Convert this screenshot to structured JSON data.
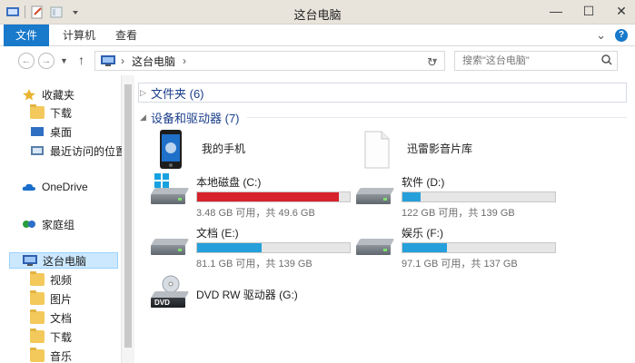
{
  "window": {
    "title": "这台电脑"
  },
  "window_controls": {
    "minimize": "—",
    "maximize": "☐",
    "close": "✕"
  },
  "ribbon": {
    "file_tab": "文件",
    "tabs": [
      "计算机",
      "查看"
    ],
    "chevron": "⌄",
    "help": "?"
  },
  "address": {
    "crumb": "这台电脑",
    "arrow": "›",
    "search_placeholder": "搜索\"这台电脑\""
  },
  "sidebar": {
    "favorites": {
      "label": "收藏夹",
      "items": [
        "下载",
        "桌面",
        "最近访问的位置"
      ]
    },
    "onedrive": "OneDrive",
    "homegroup": "家庭组",
    "thispc": {
      "label": "这台电脑",
      "items": [
        "视频",
        "图片",
        "文档",
        "下载",
        "音乐"
      ]
    }
  },
  "main": {
    "folders_group": "文件夹 (6)",
    "devices_group": "设备和驱动器 (7)",
    "items": [
      {
        "name": "我的手机",
        "icon": "phone-icon"
      },
      {
        "name": "迅雷影音片库",
        "icon": "document-icon"
      },
      {
        "name": "本地磁盘 (C:)",
        "sub": "3.48 GB 可用，共 49.6 GB",
        "used": 0.93,
        "color": "#d7232b"
      },
      {
        "name": "软件 (D:)",
        "sub": "122 GB 可用，共 139 GB",
        "used": 0.12,
        "color": "#26a0da"
      },
      {
        "name": "文档 (E:)",
        "sub": "81.1 GB 可用，共 139 GB",
        "used": 0.42,
        "color": "#26a0da"
      },
      {
        "name": "娱乐 (F:)",
        "sub": "97.1 GB 可用，共 137 GB",
        "used": 0.29,
        "color": "#26a0da"
      },
      {
        "name": "DVD RW 驱动器 (G:)",
        "icon": "dvd-drive-icon"
      }
    ]
  }
}
